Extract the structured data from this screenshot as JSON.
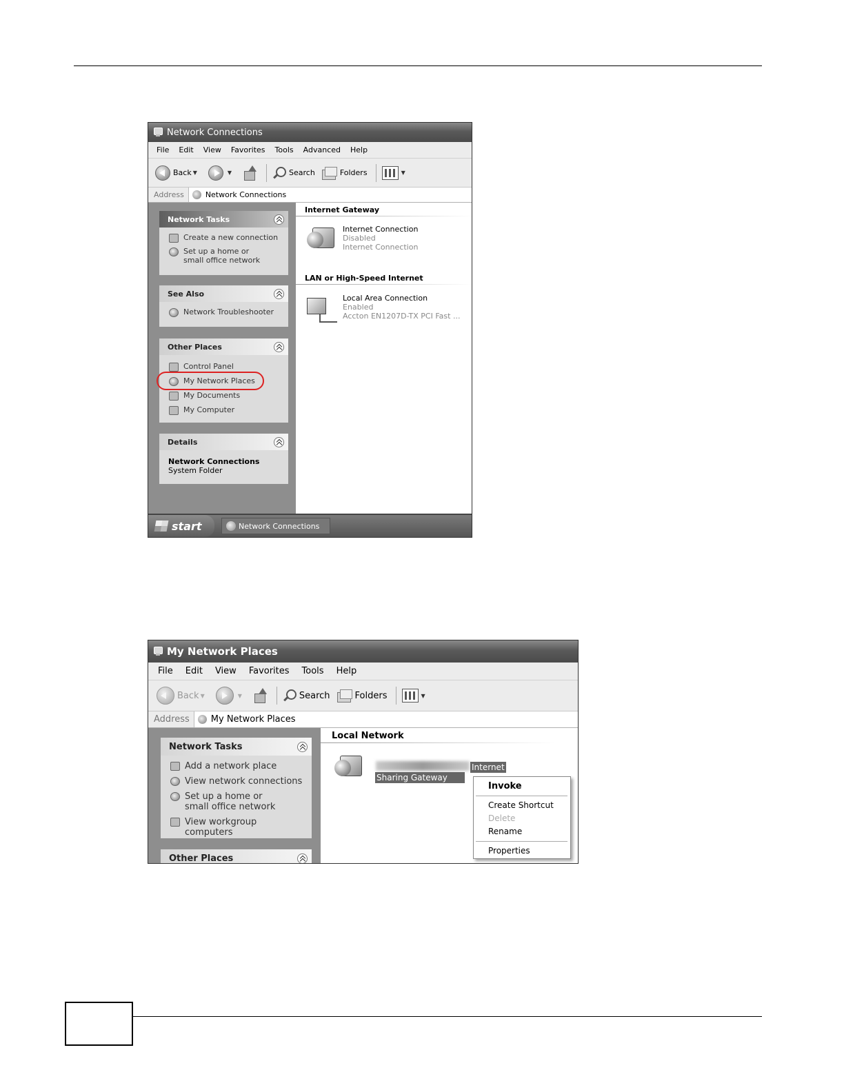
{
  "window1": {
    "title": "Network Connections",
    "menu": [
      "File",
      "Edit",
      "View",
      "Favorites",
      "Tools",
      "Advanced",
      "Help"
    ],
    "toolbar": {
      "back": "Back",
      "search": "Search",
      "folders": "Folders"
    },
    "address": {
      "label": "Address",
      "value": "Network Connections"
    },
    "network_tasks": {
      "title": "Network Tasks",
      "items": [
        "Create a new connection",
        "Set up a home or small office network"
      ]
    },
    "see_also": {
      "title": "See Also",
      "items": [
        "Network Troubleshooter"
      ]
    },
    "other_places": {
      "title": "Other Places",
      "items": [
        "Control Panel",
        "My Network Places",
        "My Documents",
        "My Computer"
      ]
    },
    "details": {
      "title": "Details",
      "name": "Network Connections",
      "type": "System Folder"
    },
    "groups": [
      {
        "title": "Internet Gateway",
        "name": "Internet Connection",
        "status": "Disabled",
        "device": "Internet Connection"
      },
      {
        "title": "LAN or High-Speed Internet",
        "name": "Local Area Connection",
        "status": "Enabled",
        "device": "Accton EN1207D-TX PCI Fast ..."
      }
    ],
    "taskbar": {
      "start": "start",
      "task": "Network Connections"
    }
  },
  "window2": {
    "title": "My Network Places",
    "menu": [
      "File",
      "Edit",
      "View",
      "Favorites",
      "Tools",
      "Help"
    ],
    "toolbar": {
      "back": "Back",
      "search": "Search",
      "folders": "Folders"
    },
    "address": {
      "label": "Address",
      "value": "My Network Places"
    },
    "network_tasks": {
      "title": "Network Tasks",
      "items": [
        "Add a network place",
        "View network connections",
        "Set up a home or small office network",
        "View workgroup computers"
      ]
    },
    "other_places": {
      "title": "Other Places"
    },
    "group_title": "Local Network",
    "device": {
      "label_right": "Internet",
      "label_bottom": "Sharing Gateway"
    },
    "context_menu": [
      "Invoke",
      "Create Shortcut",
      "Delete",
      "Rename",
      "Properties"
    ]
  }
}
